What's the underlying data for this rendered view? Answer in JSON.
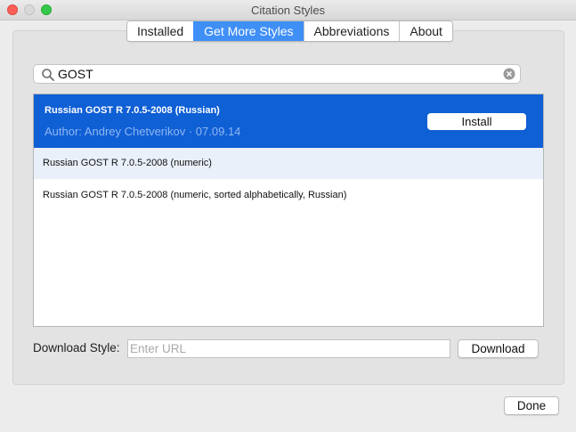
{
  "window": {
    "title": "Citation Styles"
  },
  "tabs": [
    {
      "label": "Installed",
      "active": false
    },
    {
      "label": "Get More Styles",
      "active": true
    },
    {
      "label": "Abbreviations",
      "active": false
    },
    {
      "label": "About",
      "active": false
    }
  ],
  "search": {
    "value": "GOST"
  },
  "results": {
    "selected": {
      "name": "Russian GOST R 7.0.5-2008 (Russian)",
      "author": "Author: Andrey Chetverikov · 07.09.14",
      "install_label": "Install"
    },
    "items": [
      {
        "name": "Russian GOST R 7.0.5-2008 (numeric)"
      },
      {
        "name": "Russian GOST R 7.0.5-2008 (numeric, sorted alphabetically, Russian)"
      }
    ]
  },
  "download": {
    "label": "Download Style:",
    "placeholder": "Enter URL",
    "button_label": "Download"
  },
  "footer": {
    "done_label": "Done"
  },
  "colors": {
    "accent": "#3f8ff7",
    "selection": "#0f5fd5",
    "close": "#fc5f57",
    "maximize": "#34c84a"
  }
}
